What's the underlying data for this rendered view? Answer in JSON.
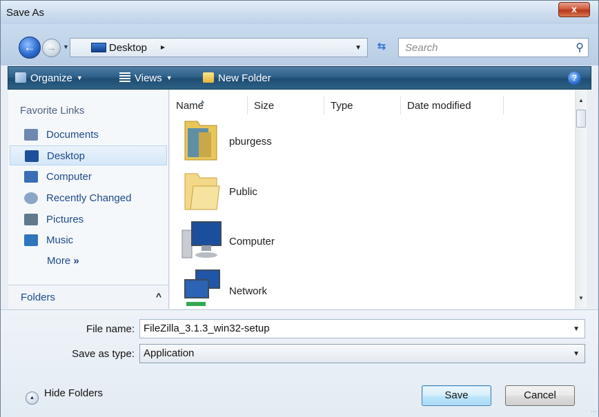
{
  "window": {
    "title": "Save As",
    "close_label": "x"
  },
  "address": {
    "location": "Desktop",
    "separator": "▸",
    "search_placeholder": "Search"
  },
  "toolbar": {
    "organize_label": "Organize",
    "views_label": "Views",
    "new_folder_label": "New Folder",
    "help_label": "?"
  },
  "nav": {
    "heading": "Favorite Links",
    "items": [
      {
        "label": "Documents",
        "icon": "documents-icon",
        "color": "#6f88b1"
      },
      {
        "label": "Desktop",
        "icon": "desktop-icon",
        "color": "#1f4f9a",
        "selected": true
      },
      {
        "label": "Computer",
        "icon": "computer-icon",
        "color": "#3a6fb7"
      },
      {
        "label": "Recently Changed",
        "icon": "recently-changed-icon",
        "color": "#8aa6c7"
      },
      {
        "label": "Pictures",
        "icon": "pictures-icon",
        "color": "#5f7a8f"
      },
      {
        "label": "Music",
        "icon": "music-icon",
        "color": "#2f76bd"
      }
    ],
    "more_label": "More",
    "more_chevron": "»",
    "folders_label": "Folders",
    "folders_chevron": "^"
  },
  "columns": [
    "Name",
    "Size",
    "Type",
    "Date modified"
  ],
  "files": [
    {
      "name": "pburgess",
      "icon": "user-folder-icon"
    },
    {
      "name": "Public",
      "icon": "folder-icon"
    },
    {
      "name": "Computer",
      "icon": "computer-icon"
    },
    {
      "name": "Network",
      "icon": "network-icon"
    }
  ],
  "form": {
    "file_name_label": "File name:",
    "file_name_value": "FileZilla_3.1.3_win32-setup",
    "save_type_label": "Save as type:",
    "save_type_value": "Application"
  },
  "actions": {
    "hide_folders_label": "Hide Folders",
    "save_label": "Save",
    "cancel_label": "Cancel"
  }
}
